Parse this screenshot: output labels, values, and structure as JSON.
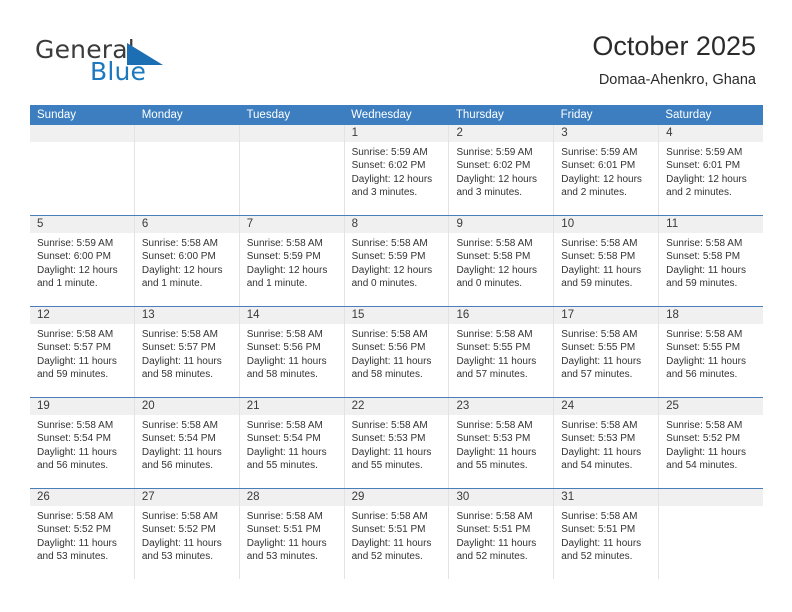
{
  "brand": {
    "name_top": "General",
    "name_bottom": "Blue",
    "accent_color": "#1c79c0"
  },
  "header": {
    "title": "October 2025",
    "location": "Domaa-Ahenkro, Ghana"
  },
  "calendar": {
    "header_bg": "#3c7ebf",
    "day_names": [
      "Sunday",
      "Monday",
      "Tuesday",
      "Wednesday",
      "Thursday",
      "Friday",
      "Saturday"
    ],
    "weeks": [
      [
        {
          "empty": true
        },
        {
          "empty": true
        },
        {
          "empty": true
        },
        {
          "day": "1",
          "sunrise": "Sunrise: 5:59 AM",
          "sunset": "Sunset: 6:02 PM",
          "daylight_line1": "Daylight: 12 hours",
          "daylight_line2": "and 3 minutes."
        },
        {
          "day": "2",
          "sunrise": "Sunrise: 5:59 AM",
          "sunset": "Sunset: 6:02 PM",
          "daylight_line1": "Daylight: 12 hours",
          "daylight_line2": "and 3 minutes."
        },
        {
          "day": "3",
          "sunrise": "Sunrise: 5:59 AM",
          "sunset": "Sunset: 6:01 PM",
          "daylight_line1": "Daylight: 12 hours",
          "daylight_line2": "and 2 minutes."
        },
        {
          "day": "4",
          "sunrise": "Sunrise: 5:59 AM",
          "sunset": "Sunset: 6:01 PM",
          "daylight_line1": "Daylight: 12 hours",
          "daylight_line2": "and 2 minutes."
        }
      ],
      [
        {
          "day": "5",
          "sunrise": "Sunrise: 5:59 AM",
          "sunset": "Sunset: 6:00 PM",
          "daylight_line1": "Daylight: 12 hours",
          "daylight_line2": "and 1 minute."
        },
        {
          "day": "6",
          "sunrise": "Sunrise: 5:58 AM",
          "sunset": "Sunset: 6:00 PM",
          "daylight_line1": "Daylight: 12 hours",
          "daylight_line2": "and 1 minute."
        },
        {
          "day": "7",
          "sunrise": "Sunrise: 5:58 AM",
          "sunset": "Sunset: 5:59 PM",
          "daylight_line1": "Daylight: 12 hours",
          "daylight_line2": "and 1 minute."
        },
        {
          "day": "8",
          "sunrise": "Sunrise: 5:58 AM",
          "sunset": "Sunset: 5:59 PM",
          "daylight_line1": "Daylight: 12 hours",
          "daylight_line2": "and 0 minutes."
        },
        {
          "day": "9",
          "sunrise": "Sunrise: 5:58 AM",
          "sunset": "Sunset: 5:58 PM",
          "daylight_line1": "Daylight: 12 hours",
          "daylight_line2": "and 0 minutes."
        },
        {
          "day": "10",
          "sunrise": "Sunrise: 5:58 AM",
          "sunset": "Sunset: 5:58 PM",
          "daylight_line1": "Daylight: 11 hours",
          "daylight_line2": "and 59 minutes."
        },
        {
          "day": "11",
          "sunrise": "Sunrise: 5:58 AM",
          "sunset": "Sunset: 5:58 PM",
          "daylight_line1": "Daylight: 11 hours",
          "daylight_line2": "and 59 minutes."
        }
      ],
      [
        {
          "day": "12",
          "sunrise": "Sunrise: 5:58 AM",
          "sunset": "Sunset: 5:57 PM",
          "daylight_line1": "Daylight: 11 hours",
          "daylight_line2": "and 59 minutes."
        },
        {
          "day": "13",
          "sunrise": "Sunrise: 5:58 AM",
          "sunset": "Sunset: 5:57 PM",
          "daylight_line1": "Daylight: 11 hours",
          "daylight_line2": "and 58 minutes."
        },
        {
          "day": "14",
          "sunrise": "Sunrise: 5:58 AM",
          "sunset": "Sunset: 5:56 PM",
          "daylight_line1": "Daylight: 11 hours",
          "daylight_line2": "and 58 minutes."
        },
        {
          "day": "15",
          "sunrise": "Sunrise: 5:58 AM",
          "sunset": "Sunset: 5:56 PM",
          "daylight_line1": "Daylight: 11 hours",
          "daylight_line2": "and 58 minutes."
        },
        {
          "day": "16",
          "sunrise": "Sunrise: 5:58 AM",
          "sunset": "Sunset: 5:55 PM",
          "daylight_line1": "Daylight: 11 hours",
          "daylight_line2": "and 57 minutes."
        },
        {
          "day": "17",
          "sunrise": "Sunrise: 5:58 AM",
          "sunset": "Sunset: 5:55 PM",
          "daylight_line1": "Daylight: 11 hours",
          "daylight_line2": "and 57 minutes."
        },
        {
          "day": "18",
          "sunrise": "Sunrise: 5:58 AM",
          "sunset": "Sunset: 5:55 PM",
          "daylight_line1": "Daylight: 11 hours",
          "daylight_line2": "and 56 minutes."
        }
      ],
      [
        {
          "day": "19",
          "sunrise": "Sunrise: 5:58 AM",
          "sunset": "Sunset: 5:54 PM",
          "daylight_line1": "Daylight: 11 hours",
          "daylight_line2": "and 56 minutes."
        },
        {
          "day": "20",
          "sunrise": "Sunrise: 5:58 AM",
          "sunset": "Sunset: 5:54 PM",
          "daylight_line1": "Daylight: 11 hours",
          "daylight_line2": "and 56 minutes."
        },
        {
          "day": "21",
          "sunrise": "Sunrise: 5:58 AM",
          "sunset": "Sunset: 5:54 PM",
          "daylight_line1": "Daylight: 11 hours",
          "daylight_line2": "and 55 minutes."
        },
        {
          "day": "22",
          "sunrise": "Sunrise: 5:58 AM",
          "sunset": "Sunset: 5:53 PM",
          "daylight_line1": "Daylight: 11 hours",
          "daylight_line2": "and 55 minutes."
        },
        {
          "day": "23",
          "sunrise": "Sunrise: 5:58 AM",
          "sunset": "Sunset: 5:53 PM",
          "daylight_line1": "Daylight: 11 hours",
          "daylight_line2": "and 55 minutes."
        },
        {
          "day": "24",
          "sunrise": "Sunrise: 5:58 AM",
          "sunset": "Sunset: 5:53 PM",
          "daylight_line1": "Daylight: 11 hours",
          "daylight_line2": "and 54 minutes."
        },
        {
          "day": "25",
          "sunrise": "Sunrise: 5:58 AM",
          "sunset": "Sunset: 5:52 PM",
          "daylight_line1": "Daylight: 11 hours",
          "daylight_line2": "and 54 minutes."
        }
      ],
      [
        {
          "day": "26",
          "sunrise": "Sunrise: 5:58 AM",
          "sunset": "Sunset: 5:52 PM",
          "daylight_line1": "Daylight: 11 hours",
          "daylight_line2": "and 53 minutes."
        },
        {
          "day": "27",
          "sunrise": "Sunrise: 5:58 AM",
          "sunset": "Sunset: 5:52 PM",
          "daylight_line1": "Daylight: 11 hours",
          "daylight_line2": "and 53 minutes."
        },
        {
          "day": "28",
          "sunrise": "Sunrise: 5:58 AM",
          "sunset": "Sunset: 5:51 PM",
          "daylight_line1": "Daylight: 11 hours",
          "daylight_line2": "and 53 minutes."
        },
        {
          "day": "29",
          "sunrise": "Sunrise: 5:58 AM",
          "sunset": "Sunset: 5:51 PM",
          "daylight_line1": "Daylight: 11 hours",
          "daylight_line2": "and 52 minutes."
        },
        {
          "day": "30",
          "sunrise": "Sunrise: 5:58 AM",
          "sunset": "Sunset: 5:51 PM",
          "daylight_line1": "Daylight: 11 hours",
          "daylight_line2": "and 52 minutes."
        },
        {
          "day": "31",
          "sunrise": "Sunrise: 5:58 AM",
          "sunset": "Sunset: 5:51 PM",
          "daylight_line1": "Daylight: 11 hours",
          "daylight_line2": "and 52 minutes."
        },
        {
          "empty": true
        }
      ]
    ]
  }
}
